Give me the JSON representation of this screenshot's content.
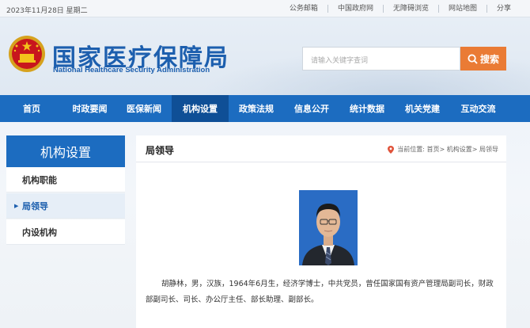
{
  "topbar": {
    "date": "2023年11月28日 星期二",
    "links": [
      "公务邮箱",
      "中国政府网",
      "无障碍浏览",
      "网站地图",
      "分享"
    ]
  },
  "header": {
    "title_cn": "国家医疗保障局",
    "title_en": "National Healthcare Security Administration",
    "emblem_icon": "national-emblem-icon"
  },
  "search": {
    "placeholder": "请输入关键字查词",
    "button_label": "搜索",
    "button_color": "#ea7b35"
  },
  "nav": {
    "items": [
      "首页",
      "时政要闻",
      "医保新闻",
      "机构设置",
      "政策法规",
      "信息公开",
      "统计数据",
      "机关党建",
      "互动交流"
    ],
    "active_index": 3,
    "color": "#1c6cc0"
  },
  "sidebar": {
    "heading": "机构设置",
    "items": [
      "机构职能",
      "局领导",
      "内设机构"
    ],
    "active_index": 1
  },
  "main": {
    "title": "局领导",
    "breadcrumb": "当前位置: 首页> 机构设置> 局领导",
    "bio": "胡静林，男，汉族，1964年6月生，经济学博士，中共党员，曾任国家国有资产管理局副司长，财政部副司长、司长、办公厅主任、部长助理、副部长。"
  }
}
